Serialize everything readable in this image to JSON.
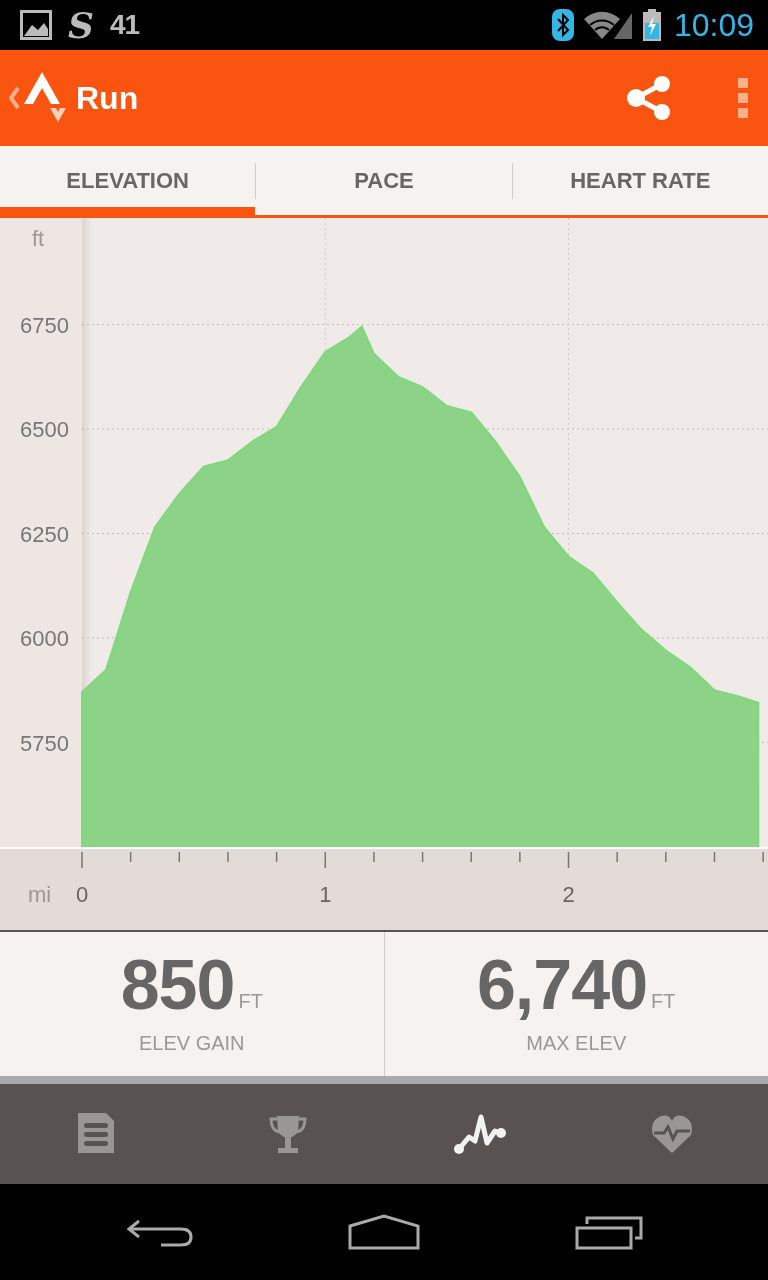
{
  "status_bar": {
    "app_letter": "S",
    "count": "41",
    "time": "10:09"
  },
  "app_bar": {
    "title": "Run"
  },
  "tabs": [
    {
      "label": "ELEVATION",
      "selected": true
    },
    {
      "label": "PACE",
      "selected": false
    },
    {
      "label": "HEART RATE",
      "selected": false
    }
  ],
  "elevation": {
    "chart_data": {
      "type": "area",
      "xlabel": "mi",
      "ylabel": "ft",
      "x": [
        0,
        0.1,
        0.2,
        0.3,
        0.4,
        0.5,
        0.6,
        0.7,
        0.8,
        0.9,
        1.0,
        1.1,
        1.15,
        1.2,
        1.3,
        1.4,
        1.5,
        1.6,
        1.7,
        1.8,
        1.9,
        2.0,
        2.1,
        2.2,
        2.3,
        2.4,
        2.5,
        2.6,
        2.7,
        2.78
      ],
      "series": [
        {
          "color": "#8cd388",
          "values": [
            5870,
            5925,
            6110,
            6265,
            6345,
            6410,
            6425,
            6470,
            6505,
            6600,
            6685,
            6720,
            6745,
            6680,
            6625,
            6600,
            6555,
            6540,
            6470,
            6385,
            6265,
            6195,
            6155,
            6085,
            6020,
            5970,
            5930,
            5875,
            5860,
            5845
          ]
        }
      ],
      "xlim": [
        0,
        2.82
      ],
      "grid": true,
      "ylim": [
        5500,
        7000
      ],
      "xticks": [
        0,
        1,
        2
      ],
      "yticks": [
        5750,
        6000,
        6250,
        6500,
        6750
      ]
    }
  },
  "stats": [
    {
      "value": "850",
      "unit": "FT",
      "label": "ELEV GAIN"
    },
    {
      "value": "6,740",
      "unit": "FT",
      "label": "MAX ELEV"
    }
  ],
  "bottom_nav": [
    {
      "kind": "summary",
      "selected": false
    },
    {
      "kind": "trophy",
      "selected": false
    },
    {
      "kind": "chart",
      "selected": true
    },
    {
      "kind": "heart",
      "selected": false
    }
  ]
}
